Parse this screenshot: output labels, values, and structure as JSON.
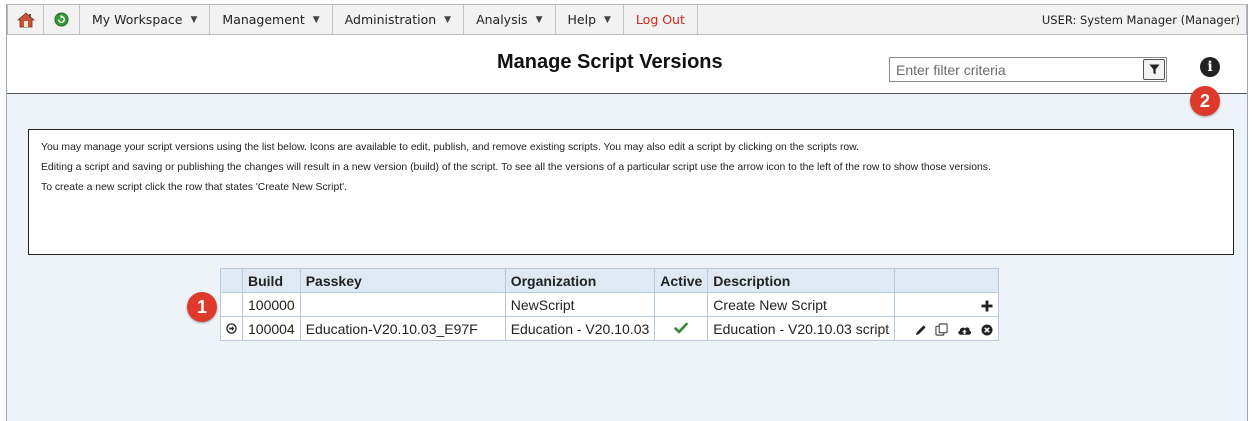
{
  "menu": {
    "items": [
      {
        "label": "My Workspace"
      },
      {
        "label": "Management"
      },
      {
        "label": "Administration"
      },
      {
        "label": "Analysis"
      },
      {
        "label": "Help"
      }
    ],
    "logout": "Log Out",
    "user": "USER: System Manager (Manager)"
  },
  "header": {
    "title": "Manage Script Versions",
    "filter_placeholder": "Enter filter criteria",
    "info_glyph": "i"
  },
  "badges": [
    "1",
    "2"
  ],
  "instructions": [
    "You may manage your script versions using the list below. Icons are available to edit, publish, and remove existing scripts. You may also edit a script by clicking on the scripts row.",
    "Editing a script and saving or publishing the changes will result in a new version (build) of the script. To see all the versions of a particular script use the arrow icon to the left of the row to show those versions.",
    "To create a new script click the row that states 'Create New Script'."
  ],
  "table": {
    "headers": [
      "Build",
      "Passkey",
      "Organization",
      "Active",
      "Description"
    ],
    "rows": [
      {
        "build": "100000",
        "passkey": "",
        "organization": "NewScript",
        "active": false,
        "description": "Create New Script"
      },
      {
        "build": "100004",
        "passkey": "Education-V20.10.03_E97F",
        "organization": "Education - V20.10.03",
        "active": true,
        "description": "Education - V20.10.03 script"
      }
    ]
  },
  "icons": {
    "home": "home-icon",
    "refresh": "refresh-icon",
    "filter": "filter-icon",
    "info": "info-icon",
    "expand": "expand-arrow-icon",
    "check": "checkmark-icon",
    "add": "plus-icon",
    "edit": "pencil-icon",
    "copy": "copy-icon",
    "publish": "cloud-upload-icon",
    "remove": "remove-icon"
  },
  "colors": {
    "logout": "#d9251c",
    "badge": "#dd3a2c",
    "check": "#2e8b2e",
    "table_header": "#dfe9f5",
    "page_bg": "#eef3fa"
  }
}
